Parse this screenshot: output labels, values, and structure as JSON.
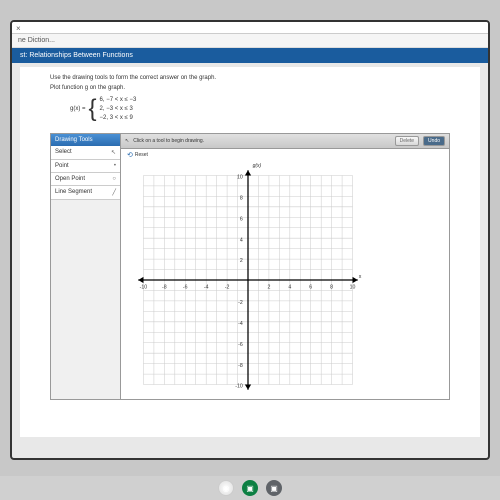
{
  "browser": {
    "tab": "ne Diction..."
  },
  "header": {
    "title": "st: Relationships Between Functions"
  },
  "instruction": "Use the drawing tools to form the correct answer on the graph.",
  "plot_label": "Plot function g on the graph.",
  "function_name": "g(x) =",
  "cases": {
    "row1": "6,   −7 < x ≤ −3",
    "row2": "2,   −3 < x ≤ 3",
    "row3": "−2,  3 < x ≤ 9"
  },
  "tools": {
    "header": "Drawing Tools",
    "items": [
      {
        "label": "Select",
        "sym": "↖"
      },
      {
        "label": "Point",
        "sym": "•"
      },
      {
        "label": "Open Point",
        "sym": "○"
      },
      {
        "label": "Line Segment",
        "sym": "╱"
      }
    ]
  },
  "panel": {
    "hint": "Click on a tool to begin drawing.",
    "delete": "Delete",
    "undo": "Undo",
    "reset": "Reset"
  },
  "graph": {
    "ylabel": "g(x)",
    "xticks": [
      "-10",
      "-8",
      "-6",
      "-4",
      "-2",
      "2",
      "4",
      "6",
      "8",
      "10"
    ],
    "yticks": [
      "10",
      "8",
      "6",
      "4",
      "2",
      "-2",
      "-4",
      "-6",
      "-8",
      "-10"
    ]
  },
  "chart_data": {
    "type": "line",
    "title": "",
    "xlabel": "x",
    "ylabel": "g(x)",
    "xlim": [
      -10,
      10
    ],
    "ylim": [
      -10,
      10
    ],
    "series": []
  }
}
